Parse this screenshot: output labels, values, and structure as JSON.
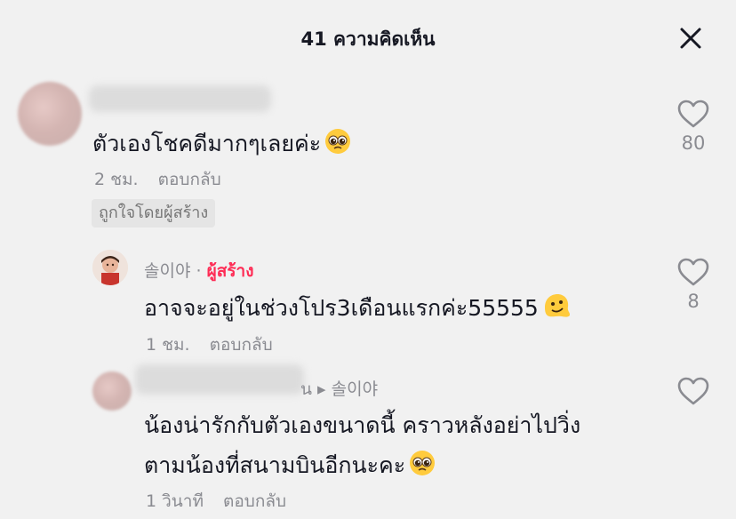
{
  "header": {
    "title": "41 ความคิดเห็น",
    "close_icon": "close-icon"
  },
  "comments": [
    {
      "text": "ตัวเองโชคดีมากๆเลยค่ะ",
      "emoji": "pleading-face-emoji",
      "time": "2 ชม.",
      "reply_label": "ตอบกลับ",
      "liked_by_creator": "ถูกใจโดยผู้สร้าง",
      "likes": "80"
    },
    {
      "username": "솔이야",
      "separator": "·",
      "creator_label": "ผู้สร้าง",
      "text": "อาจจะอยู่ในช่วงโปร3เดือนแรกค่ะ55555",
      "emoji": "melting-face-emoji",
      "time": "1 ชม.",
      "reply_label": "ตอบกลับ",
      "likes": "8"
    },
    {
      "reply_to_fragment": "น",
      "reply_to": "솔이야",
      "text_line1": "น้องน่ารักกับตัวเองขนาดนี้ คราวหลังอย่าไปวิ่ง",
      "text_line2": "ตามน้องที่สนามบินอีกนะคะ",
      "emoji": "pleading-face-emoji",
      "time": "1 วินาที",
      "reply_label": "ตอบกลับ"
    }
  ]
}
